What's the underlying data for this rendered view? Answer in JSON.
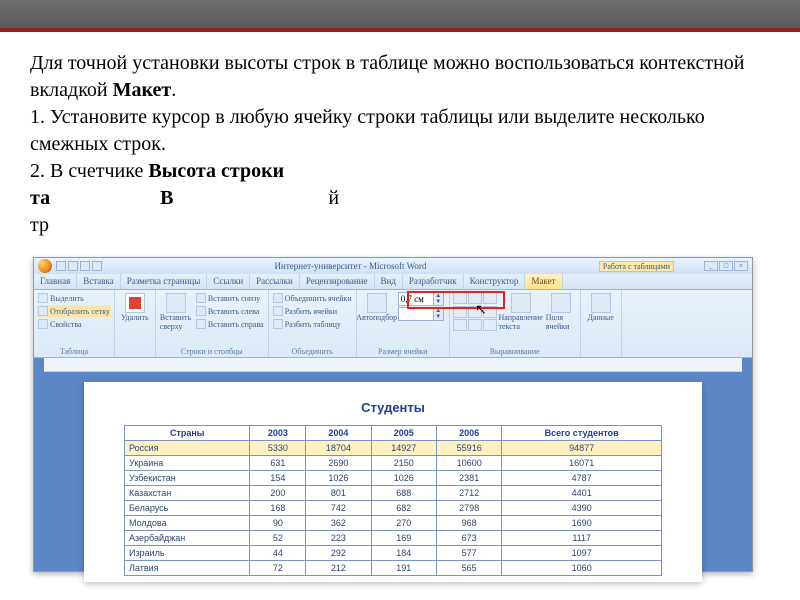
{
  "instructions": {
    "p1a": "Для точной установки высоты строк в таблице можно воспользоваться контекстной вкладкой ",
    "p1b": "Макет",
    "p1c": ".",
    "p2": "1. Установите курсор в любую ячейку строки таблицы или выделите несколько смежных строк.",
    "p3a": "2. В счетчике ",
    "p3b": "Высота строки",
    "p4a": "та",
    "p4b": "В",
    "p4c": "й",
    "p5": "тр"
  },
  "window": {
    "title": "Интернет-университет - Microsoft Word",
    "context_title": "Работа с таблицами"
  },
  "tabs": [
    "Главная",
    "Вставка",
    "Разметка страницы",
    "Ссылки",
    "Рассылки",
    "Рецензирование",
    "Вид",
    "Разработчик",
    "Конструктор",
    "Макет"
  ],
  "ribbon": {
    "g1": {
      "label": "Таблица",
      "items": [
        "Выделить",
        "Отобразить сетку",
        "Свойства"
      ]
    },
    "g2": {
      "label": "",
      "big": "Удалить"
    },
    "g3": {
      "label": "Строки и столбцы",
      "big": "Вставить сверху",
      "items": [
        "Вставить снизу",
        "Вставить слева",
        "Вставить справа"
      ]
    },
    "g4": {
      "label": "Объединить",
      "items": [
        "Объединить ячейки",
        "Разбить ячейки",
        "Разбить таблицу"
      ]
    },
    "g5": {
      "label": "Размер ячейки",
      "big": "Автоподбор",
      "h_value": "0,7 см"
    },
    "g6": {
      "label": "Выравнивание",
      "dir": "Направление текста",
      "marg": "Поля ячейки"
    },
    "g7": {
      "label": "",
      "big": "Данные"
    }
  },
  "doc": {
    "title": "Студенты",
    "headers": [
      "Страны",
      "2003",
      "2004",
      "2005",
      "2006",
      "Всего студентов"
    ],
    "rows": [
      [
        "Россия",
        "5330",
        "18704",
        "14927",
        "55916",
        "94877"
      ],
      [
        "Украина",
        "631",
        "2690",
        "2150",
        "10600",
        "16071"
      ],
      [
        "Узбекистан",
        "154",
        "1026",
        "1026",
        "2381",
        "4787"
      ],
      [
        "Казахстан",
        "200",
        "801",
        "688",
        "2712",
        "4401"
      ],
      [
        "Беларусь",
        "168",
        "742",
        "682",
        "2798",
        "4390"
      ],
      [
        "Молдова",
        "90",
        "362",
        "270",
        "968",
        "1690"
      ],
      [
        "Азербайджан",
        "52",
        "223",
        "169",
        "673",
        "1117"
      ],
      [
        "Израиль",
        "44",
        "292",
        "184",
        "577",
        "1097"
      ],
      [
        "Латвия",
        "72",
        "212",
        "191",
        "565",
        "1060"
      ]
    ]
  }
}
